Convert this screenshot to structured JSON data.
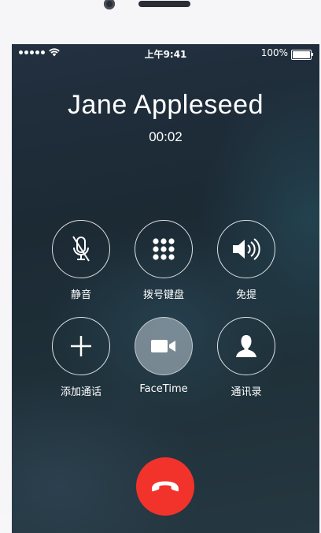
{
  "status_bar": {
    "time": "上午9:41",
    "battery": "100%"
  },
  "call": {
    "caller_name": "Jane Appleseed",
    "duration": "00:02"
  },
  "controls": [
    {
      "label": "静音",
      "icon": "mute-icon",
      "active": false
    },
    {
      "label": "拨号键盘",
      "icon": "keypad-icon",
      "active": false
    },
    {
      "label": "免提",
      "icon": "speaker-icon",
      "active": false
    },
    {
      "label": "添加通话",
      "icon": "add-call-icon",
      "active": false
    },
    {
      "label": "FaceTime",
      "icon": "facetime-icon",
      "active": true
    },
    {
      "label": "通讯录",
      "icon": "contacts-icon",
      "active": false
    }
  ],
  "end_call": {
    "icon": "end-call-icon",
    "color": "#f1332c"
  }
}
